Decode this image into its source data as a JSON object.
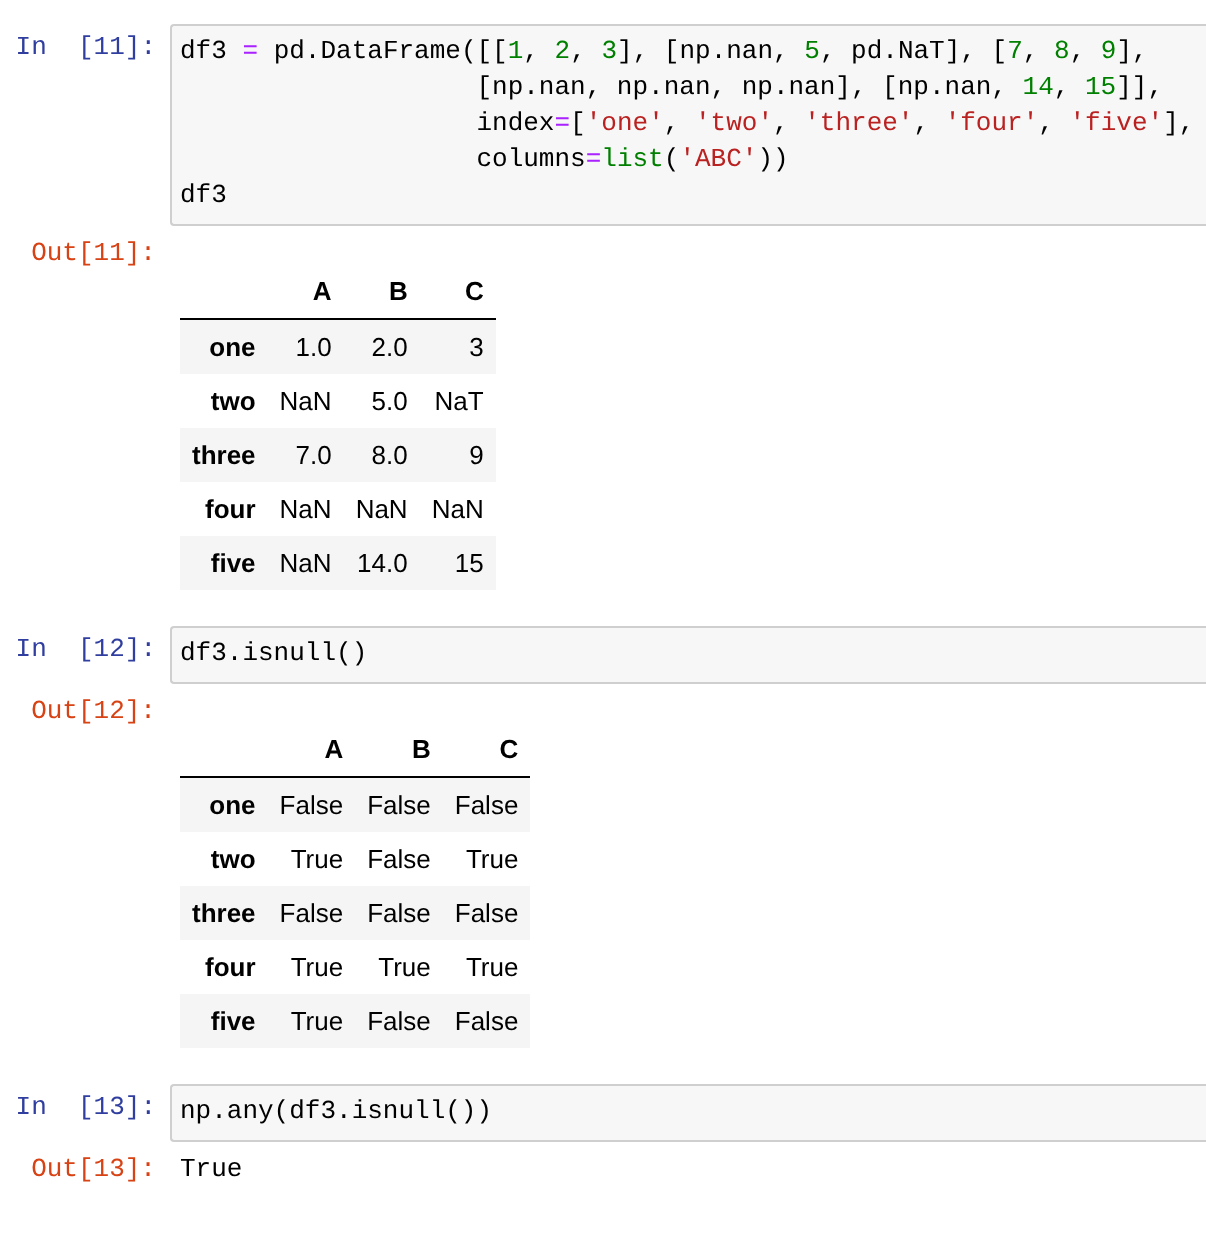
{
  "cells": [
    {
      "in_prompt": "In  [11]:",
      "code": [
        [
          {
            "kind": "plain",
            "text": "df3 "
          },
          {
            "kind": "op",
            "text": "="
          },
          {
            "kind": "plain",
            "text": " pd.DataFrame([["
          },
          {
            "kind": "num",
            "text": "1"
          },
          {
            "kind": "plain",
            "text": ", "
          },
          {
            "kind": "num",
            "text": "2"
          },
          {
            "kind": "plain",
            "text": ", "
          },
          {
            "kind": "num",
            "text": "3"
          },
          {
            "kind": "plain",
            "text": "], [np.nan, "
          },
          {
            "kind": "num",
            "text": "5"
          },
          {
            "kind": "plain",
            "text": ", pd.NaT], ["
          },
          {
            "kind": "num",
            "text": "7"
          },
          {
            "kind": "plain",
            "text": ", "
          },
          {
            "kind": "num",
            "text": "8"
          },
          {
            "kind": "plain",
            "text": ", "
          },
          {
            "kind": "num",
            "text": "9"
          },
          {
            "kind": "plain",
            "text": "],"
          }
        ],
        [
          {
            "kind": "plain",
            "text": "                   [np.nan, np.nan, np.nan], [np.nan, "
          },
          {
            "kind": "num",
            "text": "14"
          },
          {
            "kind": "plain",
            "text": ", "
          },
          {
            "kind": "num",
            "text": "15"
          },
          {
            "kind": "plain",
            "text": "]],"
          }
        ],
        [
          {
            "kind": "plain",
            "text": "                   index"
          },
          {
            "kind": "op",
            "text": "="
          },
          {
            "kind": "plain",
            "text": "["
          },
          {
            "kind": "str",
            "text": "'one'"
          },
          {
            "kind": "plain",
            "text": ", "
          },
          {
            "kind": "str",
            "text": "'two'"
          },
          {
            "kind": "plain",
            "text": ", "
          },
          {
            "kind": "str",
            "text": "'three'"
          },
          {
            "kind": "plain",
            "text": ", "
          },
          {
            "kind": "str",
            "text": "'four'"
          },
          {
            "kind": "plain",
            "text": ", "
          },
          {
            "kind": "str",
            "text": "'five'"
          },
          {
            "kind": "plain",
            "text": "],"
          }
        ],
        [
          {
            "kind": "plain",
            "text": "                   columns"
          },
          {
            "kind": "op",
            "text": "="
          },
          {
            "kind": "builtin",
            "text": "list"
          },
          {
            "kind": "plain",
            "text": "("
          },
          {
            "kind": "str",
            "text": "'ABC'"
          },
          {
            "kind": "plain",
            "text": "))"
          }
        ],
        [
          {
            "kind": "plain",
            "text": "df3"
          }
        ]
      ],
      "output": {
        "prompt": "Out[11]:",
        "kind": "table",
        "columns": [
          "A",
          "B",
          "C"
        ],
        "rows": [
          {
            "index": "one",
            "cells": [
              "1.0",
              "2.0",
              "3"
            ]
          },
          {
            "index": "two",
            "cells": [
              "NaN",
              "5.0",
              "NaT"
            ]
          },
          {
            "index": "three",
            "cells": [
              "7.0",
              "8.0",
              "9"
            ]
          },
          {
            "index": "four",
            "cells": [
              "NaN",
              "NaN",
              "NaN"
            ]
          },
          {
            "index": "five",
            "cells": [
              "NaN",
              "14.0",
              "15"
            ]
          }
        ]
      }
    },
    {
      "in_prompt": "In  [12]:",
      "code": [
        [
          {
            "kind": "plain",
            "text": "df3.isnull()"
          }
        ]
      ],
      "output": {
        "prompt": "Out[12]:",
        "kind": "table",
        "columns": [
          "A",
          "B",
          "C"
        ],
        "rows": [
          {
            "index": "one",
            "cells": [
              "False",
              "False",
              "False"
            ]
          },
          {
            "index": "two",
            "cells": [
              "True",
              "False",
              "True"
            ]
          },
          {
            "index": "three",
            "cells": [
              "False",
              "False",
              "False"
            ]
          },
          {
            "index": "four",
            "cells": [
              "True",
              "True",
              "True"
            ]
          },
          {
            "index": "five",
            "cells": [
              "True",
              "False",
              "False"
            ]
          }
        ]
      }
    },
    {
      "in_prompt": "In  [13]:",
      "code": [
        [
          {
            "kind": "plain",
            "text": "np.any(df3.isnull())"
          }
        ]
      ],
      "output": {
        "prompt": "Out[13]:",
        "kind": "text",
        "text": "True"
      }
    }
  ]
}
